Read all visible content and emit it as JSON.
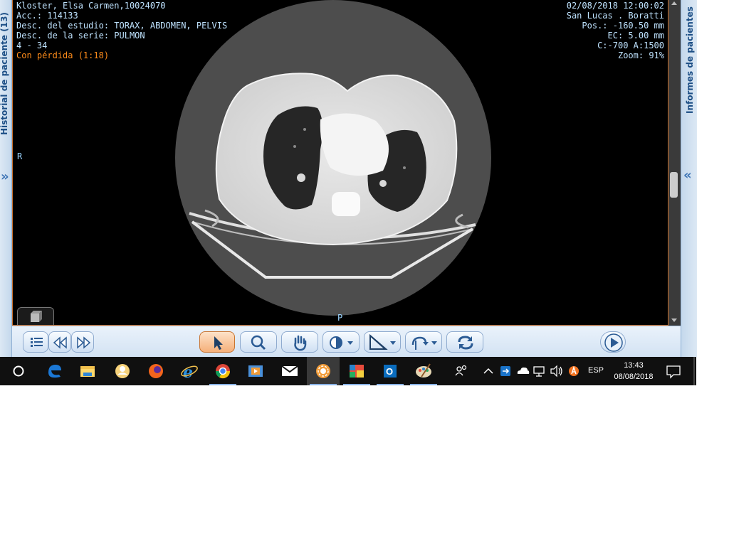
{
  "panels": {
    "left_title": "Historial de paciente (13)",
    "right_title": "Informes de pacientes",
    "expand_icon": "«"
  },
  "overlay": {
    "patient": "Kloster, Elsa Carmen,10024070",
    "accession": "Acc.: 114133",
    "study_desc": "Desc. del estudio: TORAX, ABDOMEN, PELVIS",
    "series_desc": "Desc. de la serie: PULMON",
    "image_index": "4 - 34",
    "compression": "Con pérdida (1:18)",
    "datetime": "02/08/2018 12:00:02",
    "institution": "San Lucas . Boratti",
    "position": "Pos.: -160.50 mm",
    "thickness": "EC: 5.00 mm",
    "window": "C:-700 A:1500",
    "zoom": "Zoom: 91%",
    "orientation_right": "R",
    "orientation_posterior": "P"
  },
  "toolbar": {
    "buttons": [
      {
        "name": "series-list-icon"
      },
      {
        "name": "prev-series-icon"
      },
      {
        "name": "next-series-icon"
      },
      {
        "name": "pointer-tool-icon",
        "active": true
      },
      {
        "name": "zoom-tool-icon"
      },
      {
        "name": "pan-hand-icon"
      },
      {
        "name": "window-level-icon"
      },
      {
        "name": "measure-tool-icon"
      },
      {
        "name": "rotate-flip-icon"
      },
      {
        "name": "reset-refresh-icon"
      },
      {
        "name": "cine-play-icon"
      }
    ]
  },
  "taskbar": {
    "lang": "ESP",
    "time": "13:43",
    "date": "08/08/2018",
    "icons": [
      "start-circle-icon",
      "edge-icon",
      "file-explorer-icon",
      "people-app-icon",
      "firefox-icon",
      "internet-explorer-icon",
      "chrome-icon",
      "media-player-icon",
      "mail-icon",
      "dicom-viewer-icon",
      "color-palette-app-icon",
      "outlook-icon",
      "paint-icon",
      "people-tray-icon",
      "chevron-up-icon",
      "teamviewer-icon",
      "onedrive-icon",
      "network-icon",
      "volume-icon",
      "avast-icon",
      "notifications-icon"
    ]
  },
  "colors": {
    "overlay_text": "#bfe3ff",
    "overlay_warning": "#ff8c1a",
    "panel_accent": "#1d4f86"
  }
}
